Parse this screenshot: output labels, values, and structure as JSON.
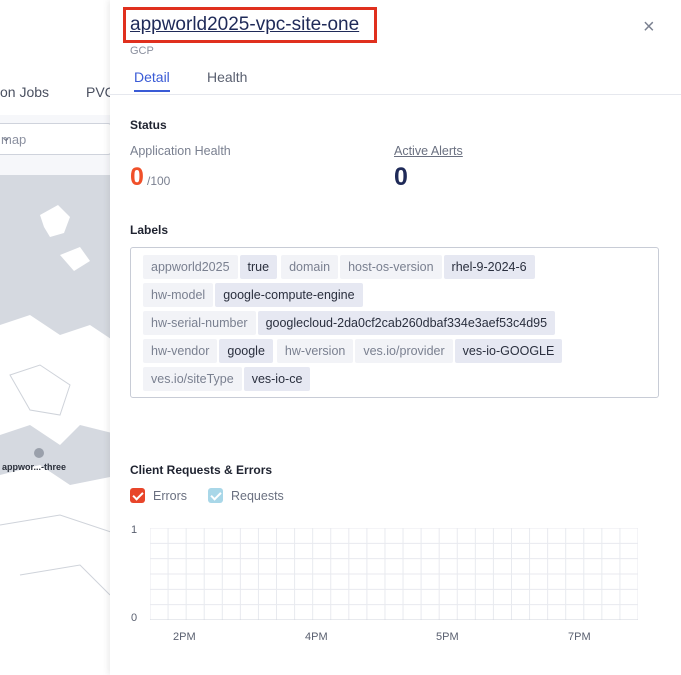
{
  "background": {
    "tabs": [
      "on Jobs",
      "PVC"
    ],
    "select_value": "map",
    "map_label": "appwor...-three"
  },
  "panel": {
    "title": "appworld2025-vpc-site-one",
    "subtitle": "GCP",
    "close_glyph": "×",
    "tabs": [
      {
        "label": "Detail",
        "active": true
      },
      {
        "label": "Health",
        "active": false
      }
    ]
  },
  "status": {
    "heading": "Status",
    "app_health_label": "Application Health",
    "app_health_value": "0",
    "app_health_max": "/100",
    "active_alerts_label": "Active Alerts",
    "active_alerts_value": "0"
  },
  "labels": {
    "heading": "Labels",
    "rows": [
      [
        {
          "k": "appworld2025",
          "v": "true"
        },
        {
          "k": "domain",
          "v": ""
        },
        {
          "k": "host-os-version",
          "v": "rhel-9-2024-6"
        }
      ],
      [
        {
          "k": "hw-model",
          "v": "google-compute-engine"
        }
      ],
      [
        {
          "k": "hw-serial-number",
          "v": "googlecloud-2da0cf2cab260dbaf334e3aef53c4d95"
        }
      ],
      [
        {
          "k": "hw-vendor",
          "v": "google"
        },
        {
          "k": "hw-version",
          "v": ""
        },
        {
          "k": "ves.io/provider",
          "v": "ves-io-GOOGLE"
        }
      ],
      [
        {
          "k": "ves.io/siteType",
          "v": "ves-io-ce"
        }
      ]
    ]
  },
  "client_requests": {
    "heading": "Client Requests & Errors",
    "legend": [
      {
        "label": "Errors",
        "color": "#e8452a"
      },
      {
        "label": "Requests",
        "color": "#a9d7e8"
      }
    ],
    "chart_data": {
      "type": "line",
      "x_tick_labels": [
        "2PM",
        "4PM",
        "5PM",
        "7PM"
      ],
      "y_tick_labels": [
        "1",
        "0"
      ],
      "ylim": [
        0,
        1
      ],
      "series": [
        {
          "name": "Errors",
          "values": []
        },
        {
          "name": "Requests",
          "values": []
        }
      ]
    }
  }
}
